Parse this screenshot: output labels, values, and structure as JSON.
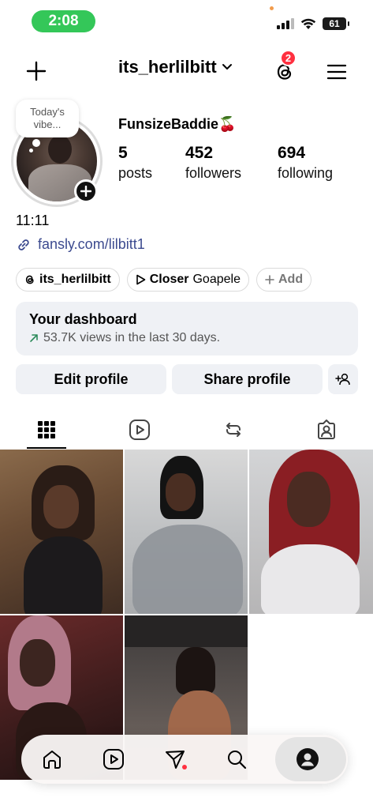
{
  "status_bar": {
    "time": "2:08",
    "battery": "61"
  },
  "header": {
    "username": "its_herlilbitt",
    "notification_count": "2"
  },
  "profile": {
    "note": "Today's vibe...",
    "display_name": "FunsizeBaddie🍒",
    "stats": [
      {
        "value": "5",
        "label": "posts"
      },
      {
        "value": "452",
        "label": "followers"
      },
      {
        "value": "694",
        "label": "following"
      }
    ],
    "bio_text": "11:11",
    "link": "fansly.com/lilbitt1"
  },
  "pills": {
    "threads": "its_herlilbitt",
    "music_title": "Closer",
    "music_artist": "Goapele",
    "add": "Add"
  },
  "dashboard": {
    "title": "Your dashboard",
    "subtitle": "53.7K views in the last 30 days."
  },
  "actions": {
    "edit": "Edit profile",
    "share": "Share profile"
  },
  "tabs": [
    "grid",
    "reels",
    "reposts",
    "tagged"
  ],
  "colors": {
    "accent_green": "#34c759",
    "badge_red": "#ff3040",
    "link_blue": "#3c4a8f"
  }
}
